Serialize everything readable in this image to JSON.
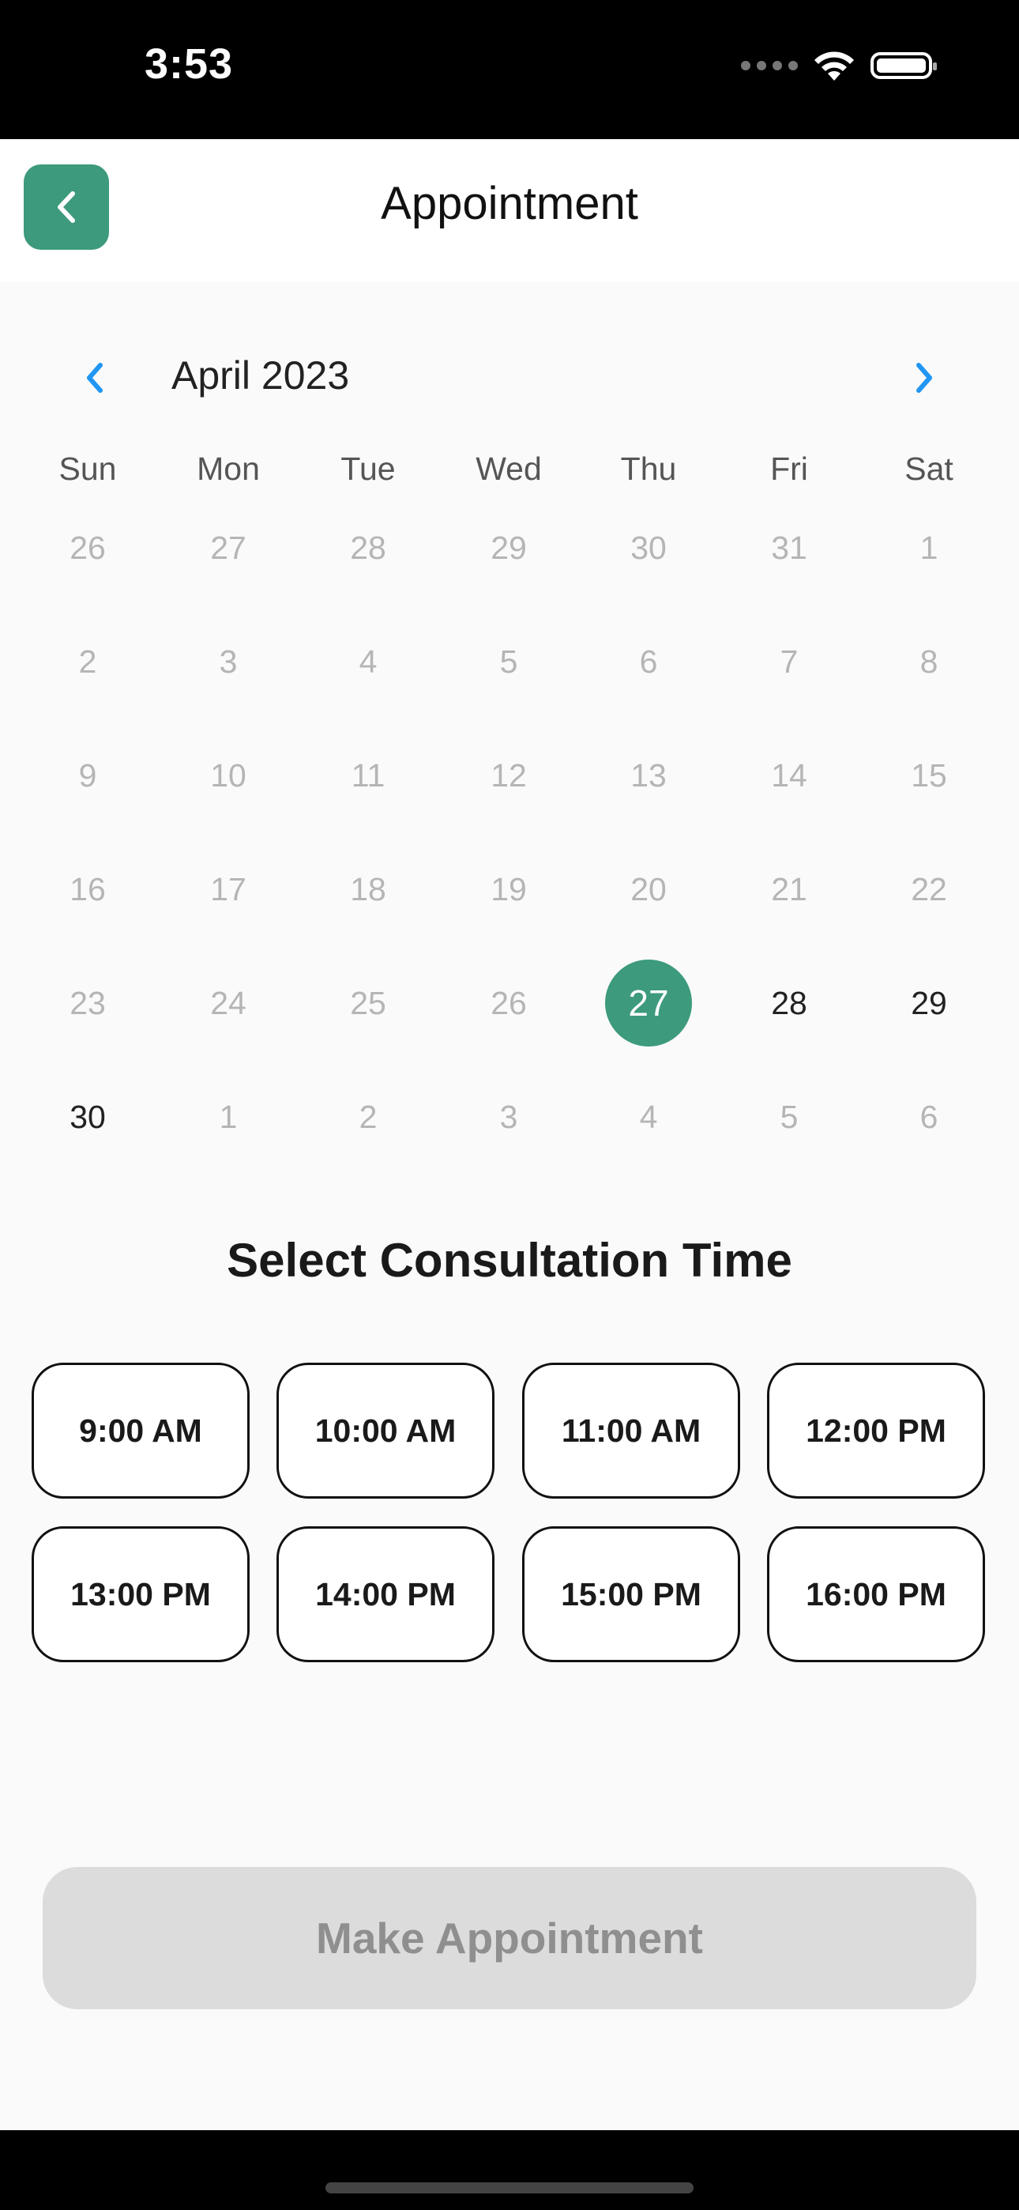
{
  "status_bar": {
    "time": "3:53"
  },
  "header": {
    "title": "Appointment",
    "back_icon": "chevron-left-icon",
    "accent_color": "#3d9a7d"
  },
  "calendar": {
    "month_label": "April 2023",
    "prev_icon": "chevron-left-icon",
    "next_icon": "chevron-right-icon",
    "weekdays": [
      "Sun",
      "Mon",
      "Tue",
      "Wed",
      "Thu",
      "Fri",
      "Sat"
    ],
    "weeks": [
      [
        "26",
        "27",
        "28",
        "29",
        "30",
        "31",
        "1"
      ],
      [
        "2",
        "3",
        "4",
        "5",
        "6",
        "7",
        "8"
      ],
      [
        "9",
        "10",
        "11",
        "12",
        "13",
        "14",
        "15"
      ],
      [
        "16",
        "17",
        "18",
        "19",
        "20",
        "21",
        "22"
      ],
      [
        "23",
        "24",
        "25",
        "26",
        "27",
        "28",
        "29"
      ],
      [
        "30",
        "1",
        "2",
        "3",
        "4",
        "5",
        "6"
      ]
    ],
    "selected_day": "27",
    "enabled_days": [
      "28",
      "29",
      "30"
    ]
  },
  "time_selection": {
    "title": "Select Consultation Time",
    "slots": [
      "9:00 AM",
      "10:00 AM",
      "11:00 AM",
      "12:00 PM",
      "13:00 PM",
      "14:00 PM",
      "15:00 PM",
      "16:00 PM"
    ]
  },
  "cta": {
    "label": "Make Appointment",
    "disabled_color": "#dcdcdc"
  }
}
